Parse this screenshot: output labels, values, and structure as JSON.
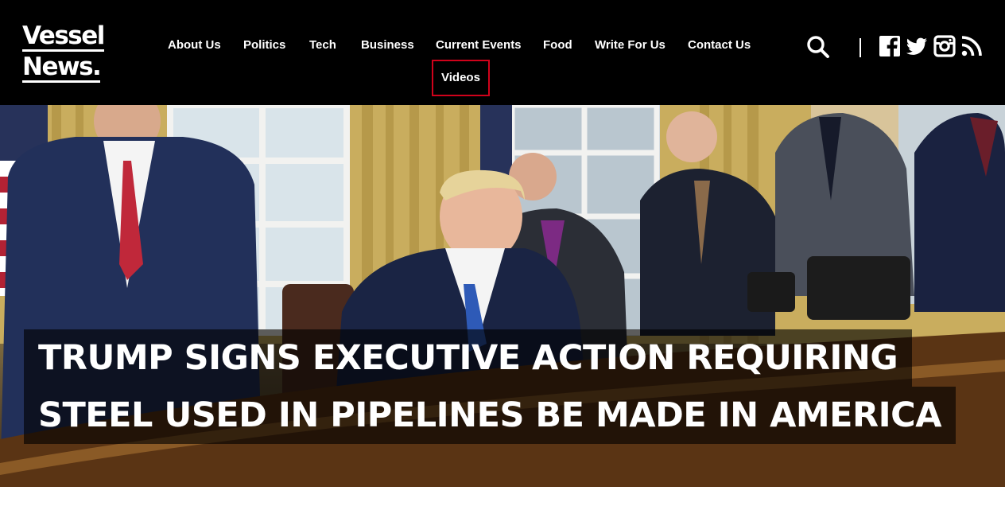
{
  "site": {
    "logo_line1": "Vessel",
    "logo_line2": "News.",
    "background_color": "#000000",
    "text_color": "#ffffff",
    "active_outline_color": "#d0021b"
  },
  "nav": {
    "items": [
      {
        "label": "About Us"
      },
      {
        "label": "Politics"
      },
      {
        "label": "Tech"
      },
      {
        "label": "Business"
      },
      {
        "label": "Current Events"
      },
      {
        "label": "Food"
      },
      {
        "label": "Write For Us"
      },
      {
        "label": "Contact Us"
      },
      {
        "label": "Videos",
        "highlighted": true
      }
    ]
  },
  "tools": {
    "icons": [
      "search-icon",
      "facebook-icon",
      "twitter-icon",
      "instagram-icon",
      "rss-icon"
    ]
  },
  "hero": {
    "headline_line1": "Trump Signs Executive Action Requiring",
    "headline_line2": "Steel Used In Pipelines Be Made In America"
  }
}
